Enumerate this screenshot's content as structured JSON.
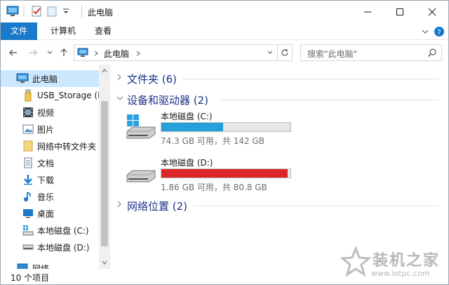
{
  "titlebar": {
    "title": "此电脑",
    "minimize_label": "—",
    "maximize_label": "☐",
    "close_label": "✕"
  },
  "ribbon": {
    "tabs": [
      {
        "label": "文件",
        "active": true
      },
      {
        "label": "计算机",
        "active": false
      },
      {
        "label": "查看",
        "active": false
      }
    ]
  },
  "address_bar": {
    "location": "此电脑",
    "search_placeholder": "搜索\"此电脑\""
  },
  "nav_pane": {
    "items": [
      {
        "label": "此电脑",
        "icon": "computer-icon",
        "selected": true
      },
      {
        "label": "USB_Storage (F",
        "icon": "usb-drive-icon",
        "selected": false
      },
      {
        "label": "视频",
        "icon": "video-icon",
        "selected": false
      },
      {
        "label": "图片",
        "icon": "pictures-icon",
        "selected": false
      },
      {
        "label": "网络中转文件夹",
        "icon": "folder-icon",
        "selected": false
      },
      {
        "label": "文档",
        "icon": "documents-icon",
        "selected": false
      },
      {
        "label": "下载",
        "icon": "download-icon",
        "selected": false
      },
      {
        "label": "音乐",
        "icon": "music-icon",
        "selected": false
      },
      {
        "label": "桌面",
        "icon": "desktop-icon",
        "selected": false
      },
      {
        "label": "本地磁盘 (C:)",
        "icon": "drive-c-icon",
        "selected": false
      },
      {
        "label": "本地磁盘 (D:)",
        "icon": "drive-icon",
        "selected": false
      },
      {
        "label": "网络",
        "icon": "network-icon",
        "selected": false
      }
    ]
  },
  "content": {
    "groups": [
      {
        "title": "文件夹 (6)",
        "expanded": false
      },
      {
        "title": "设备和驱动器 (2)",
        "expanded": true
      },
      {
        "title": "网络位置 (2)",
        "expanded": false
      }
    ],
    "drives": [
      {
        "name": "本地磁盘 (C:)",
        "info": "74.3 GB 可用，共 142 GB",
        "used_fraction": 0.48,
        "bar_color": "#26a0da",
        "icon": "windows-drive-icon"
      },
      {
        "name": "本地磁盘 (D:)",
        "info": "1.86 GB 可用，共 80.8 GB",
        "used_fraction": 0.977,
        "bar_color": "#da2626",
        "icon": "hard-drive-icon"
      }
    ]
  },
  "statusbar": {
    "item_count": "10 个项目"
  },
  "watermark": {
    "text": "装机之家",
    "url": "www.lotpc.com"
  },
  "colors": {
    "accent": "#1979ca",
    "selection": "#cce8ff",
    "group_title": "#1e3287",
    "bar_normal": "#26a0da",
    "bar_full": "#da2626"
  }
}
